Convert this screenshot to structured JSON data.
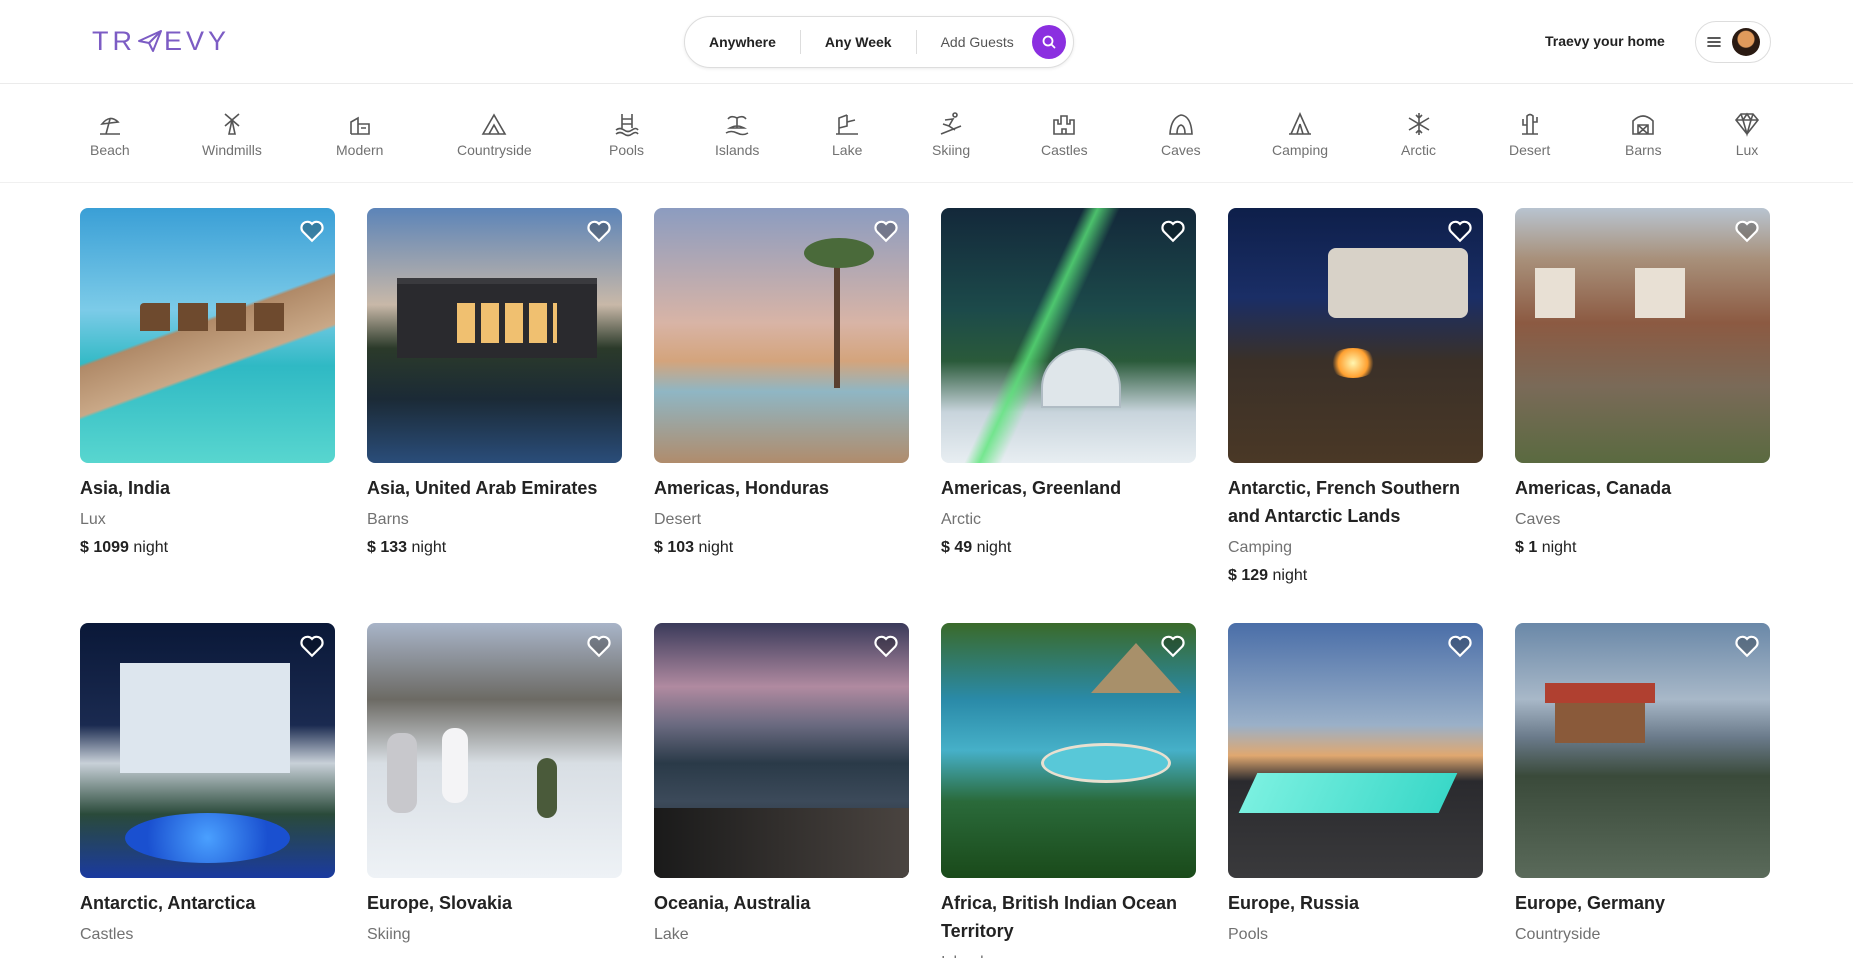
{
  "brand": {
    "logo_text_left": "TR",
    "logo_text_right": "EVY",
    "accent": "#7c5cc4",
    "search_color": "#8b2fe0"
  },
  "search": {
    "anywhere": "Anywhere",
    "any_week": "Any Week",
    "add_guests": "Add Guests"
  },
  "header": {
    "host_link": "Traevy your home"
  },
  "categories": [
    {
      "label": "Beach",
      "icon": "beach-icon"
    },
    {
      "label": "Windmills",
      "icon": "windmill-icon"
    },
    {
      "label": "Modern",
      "icon": "modern-icon"
    },
    {
      "label": "Countryside",
      "icon": "countryside-icon"
    },
    {
      "label": "Pools",
      "icon": "pool-icon"
    },
    {
      "label": "Islands",
      "icon": "island-icon"
    },
    {
      "label": "Lake",
      "icon": "lake-icon"
    },
    {
      "label": "Skiing",
      "icon": "skiing-icon"
    },
    {
      "label": "Castles",
      "icon": "castle-icon"
    },
    {
      "label": "Caves",
      "icon": "cave-icon"
    },
    {
      "label": "Camping",
      "icon": "camping-icon"
    },
    {
      "label": "Arctic",
      "icon": "snowflake-icon"
    },
    {
      "label": "Desert",
      "icon": "cactus-icon"
    },
    {
      "label": "Barns",
      "icon": "barn-icon"
    },
    {
      "label": "Lux",
      "icon": "diamond-icon"
    }
  ],
  "listings": [
    {
      "title": "Asia, India",
      "category": "Lux",
      "price": "$ 1099",
      "unit": "night"
    },
    {
      "title": "Asia, United Arab Emirates",
      "category": "Barns",
      "price": "$ 133",
      "unit": "night"
    },
    {
      "title": "Americas, Honduras",
      "category": "Desert",
      "price": "$ 103",
      "unit": "night"
    },
    {
      "title": "Americas, Greenland",
      "category": "Arctic",
      "price": "$ 49",
      "unit": "night"
    },
    {
      "title": "Antarctic, French Southern and Antarctic Lands",
      "category": "Camping",
      "price": "$ 129",
      "unit": "night"
    },
    {
      "title": "Americas, Canada",
      "category": "Caves",
      "price": "$ 1",
      "unit": "night"
    },
    {
      "title": "Antarctic, Antarctica",
      "category": "Castles"
    },
    {
      "title": "Europe, Slovakia",
      "category": "Skiing"
    },
    {
      "title": "Oceania, Australia",
      "category": "Lake"
    },
    {
      "title": "Africa, British Indian Ocean Territory",
      "category": "Islands"
    },
    {
      "title": "Europe, Russia",
      "category": "Pools"
    },
    {
      "title": "Europe, Germany",
      "category": "Countryside"
    }
  ]
}
